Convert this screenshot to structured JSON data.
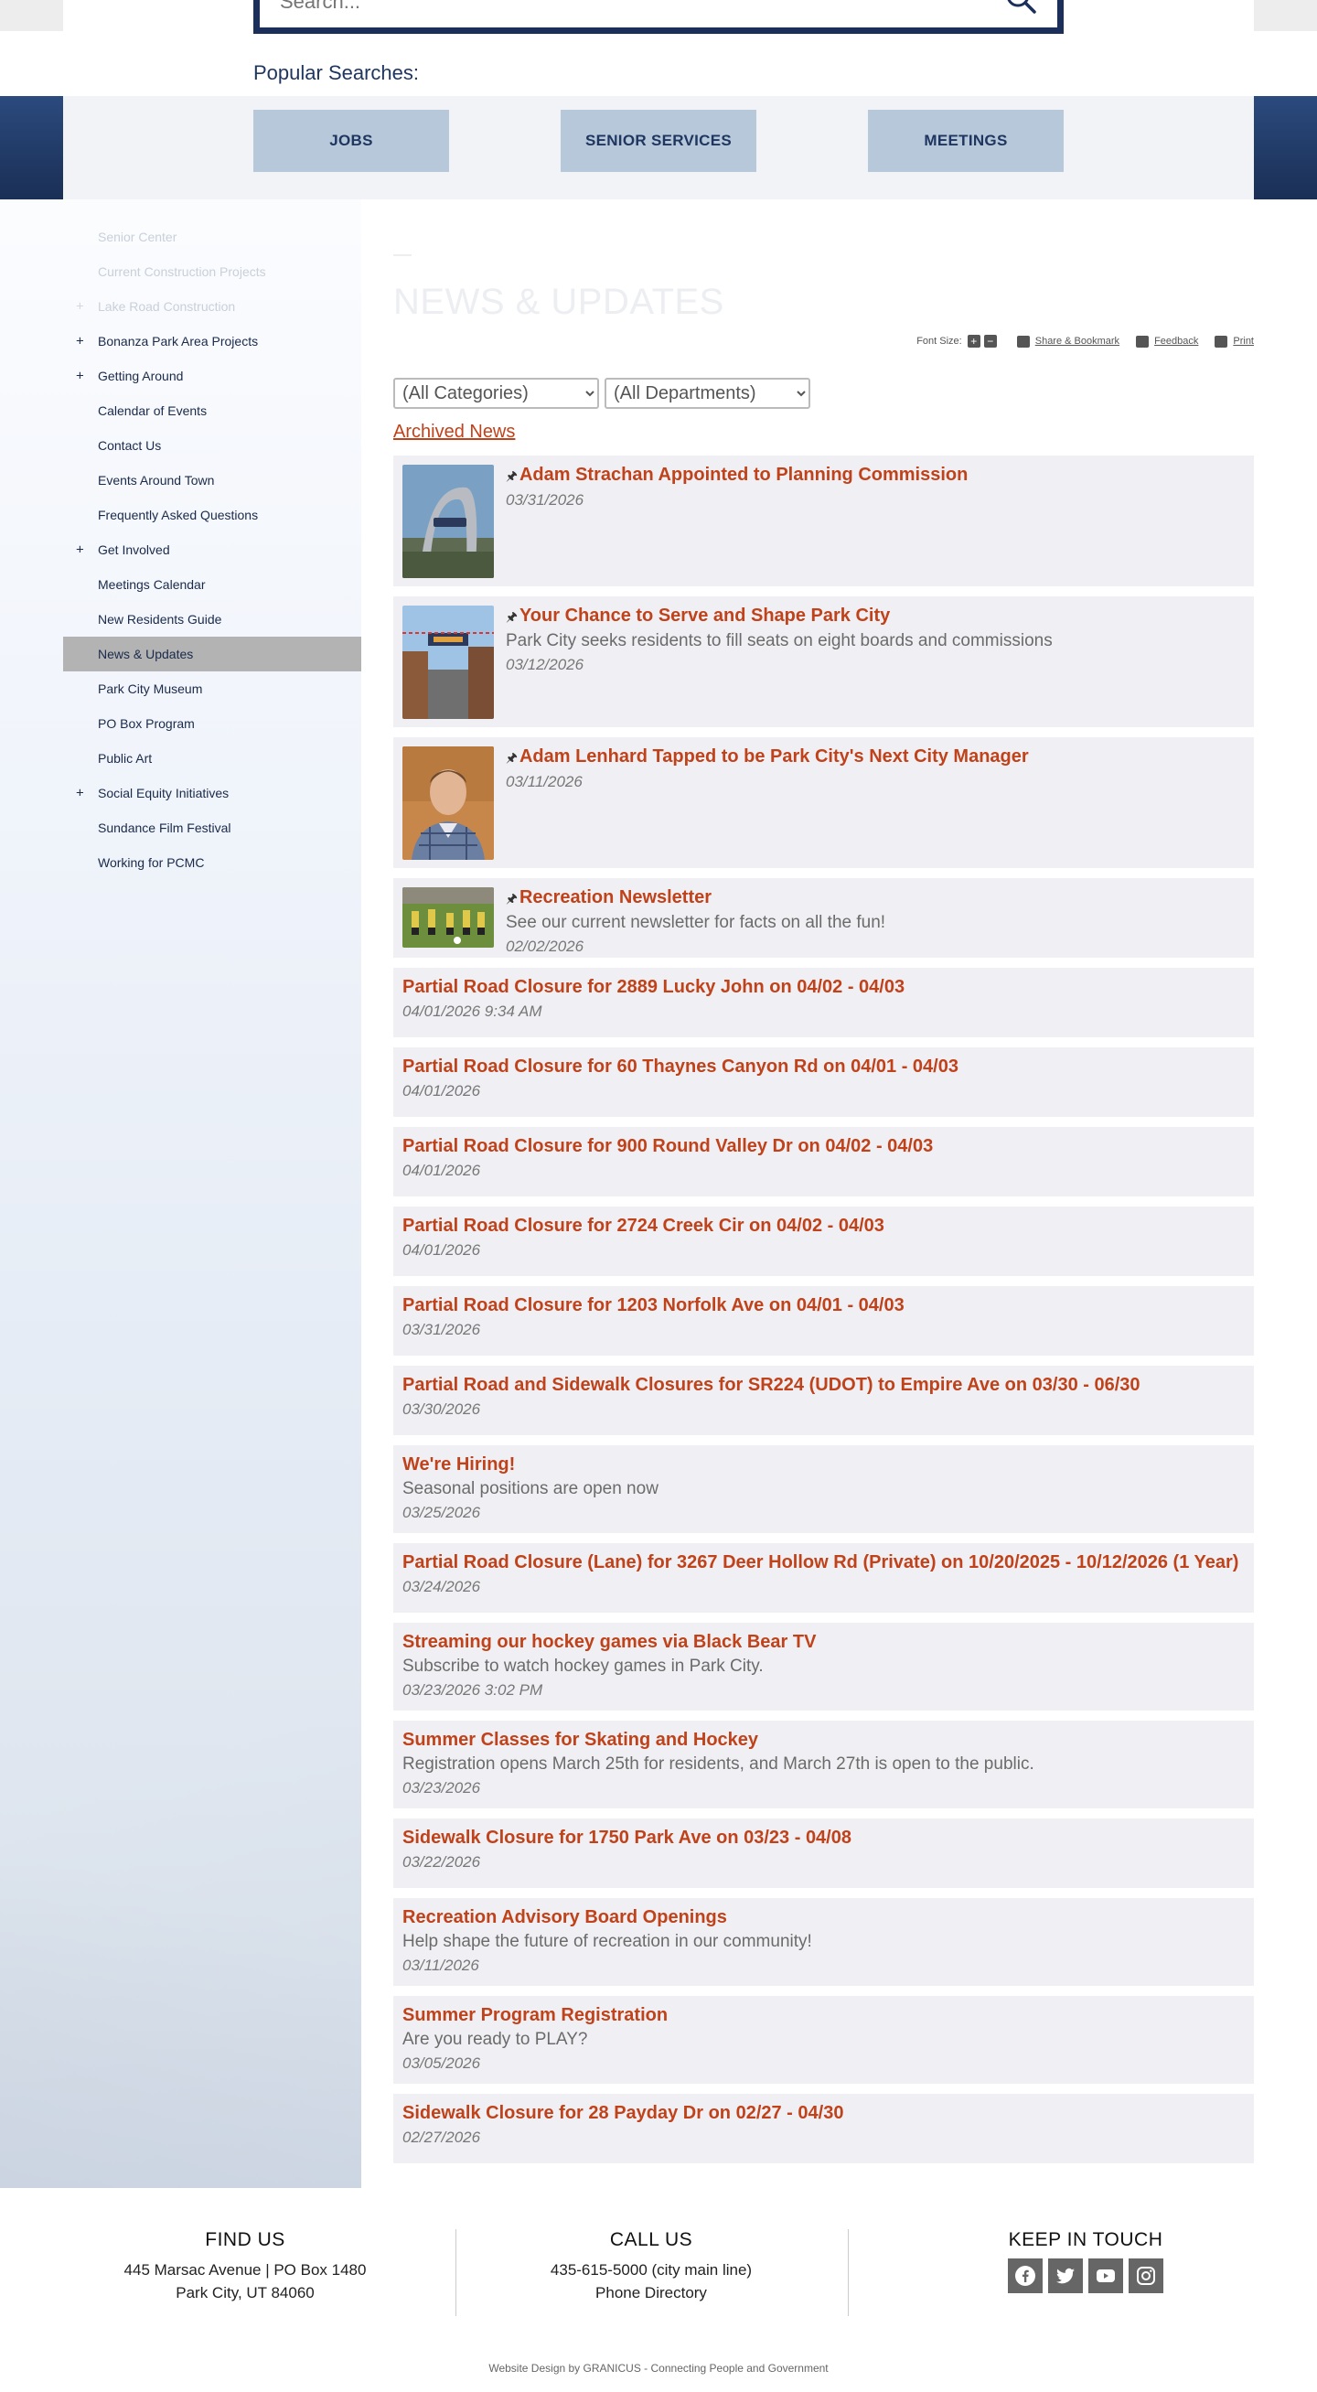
{
  "search": {
    "placeholder": "Search..."
  },
  "popular": {
    "label": "Popular Searches:",
    "buttons": [
      "JOBS",
      "SENIOR SERVICES",
      "MEETINGS"
    ]
  },
  "sidebar": {
    "items": [
      {
        "label": "Senior Center",
        "expand": false,
        "faded": true
      },
      {
        "label": "Current Construction Projects",
        "expand": false,
        "faded": true
      },
      {
        "label": "Lake Road Construction",
        "expand": true,
        "faded": true
      },
      {
        "label": "Bonanza Park Area Projects",
        "expand": true,
        "faded": false
      },
      {
        "label": "Getting Around",
        "expand": true,
        "faded": false
      },
      {
        "label": "Calendar of Events",
        "expand": false,
        "faded": false
      },
      {
        "label": "Contact Us",
        "expand": false,
        "faded": false
      },
      {
        "label": "Events Around Town",
        "expand": false,
        "faded": false
      },
      {
        "label": "Frequently Asked Questions",
        "expand": false,
        "faded": false
      },
      {
        "label": "Get Involved",
        "expand": true,
        "faded": false
      },
      {
        "label": "Meetings Calendar",
        "expand": false,
        "faded": false
      },
      {
        "label": "New Residents Guide",
        "expand": false,
        "faded": false
      },
      {
        "label": "News & Updates",
        "expand": false,
        "faded": false,
        "active": true
      },
      {
        "label": "Park City Museum",
        "expand": false,
        "faded": false
      },
      {
        "label": "PO Box Program",
        "expand": false,
        "faded": false
      },
      {
        "label": "Public Art",
        "expand": false,
        "faded": false
      },
      {
        "label": "Social Equity Initiatives",
        "expand": true,
        "faded": false
      },
      {
        "label": "Sundance Film Festival",
        "expand": false,
        "faded": false
      },
      {
        "label": "Working for PCMC",
        "expand": false,
        "faded": false
      }
    ]
  },
  "page": {
    "title": "NEWS & UPDATES",
    "tools": {
      "font_size_label": "Font Size:",
      "share": "Share & Bookmark",
      "feedback": "Feedback",
      "print": "Print"
    },
    "filters": {
      "categories": "(All Categories)",
      "departments": "(All Departments)"
    },
    "archived_link": "Archived News"
  },
  "news": [
    {
      "title": "Adam Strachan Appointed to Planning Commission",
      "desc": "",
      "date": "03/31/2026",
      "pinned": true,
      "thumb": "sign"
    },
    {
      "title": "Your Chance to Serve and Shape Park City",
      "desc": "Park City seeks residents to fill seats on eight boards and commissions",
      "date": "03/12/2026",
      "pinned": true,
      "thumb": "street"
    },
    {
      "title": "Adam Lenhard Tapped to be Park City's Next City Manager",
      "desc": "",
      "date": "03/11/2026",
      "pinned": true,
      "thumb": "portrait"
    },
    {
      "title": "Recreation Newsletter",
      "desc": "See our current newsletter for facts on all the fun!",
      "date": "02/02/2026",
      "pinned": true,
      "thumb": "field"
    },
    {
      "title": "Partial Road Closure for 2889 Lucky John on 04/02 - 04/03",
      "desc": "",
      "date": "04/01/2026 9:34 AM",
      "pinned": false
    },
    {
      "title": "Partial Road Closure for 60 Thaynes Canyon Rd on 04/01 - 04/03",
      "desc": "",
      "date": "04/01/2026",
      "pinned": false
    },
    {
      "title": "Partial Road Closure for 900 Round Valley Dr on 04/02 - 04/03",
      "desc": "",
      "date": "04/01/2026",
      "pinned": false
    },
    {
      "title": "Partial Road Closure for 2724 Creek Cir on 04/02 - 04/03",
      "desc": "",
      "date": "04/01/2026",
      "pinned": false
    },
    {
      "title": "Partial Road Closure for 1203 Norfolk Ave on 04/01 - 04/03",
      "desc": "",
      "date": "03/31/2026",
      "pinned": false
    },
    {
      "title": "Partial Road and Sidewalk Closures for SR224 (UDOT) to Empire Ave on 03/30 - 06/30",
      "desc": "",
      "date": "03/30/2026",
      "pinned": false
    },
    {
      "title": "We're Hiring!",
      "desc": "Seasonal positions are open now",
      "date": "03/25/2026",
      "pinned": false
    },
    {
      "title": "Partial Road Closure (Lane) for 3267 Deer Hollow Rd (Private) on 10/20/2025 - 10/12/2026 (1 Year)",
      "desc": "",
      "date": "03/24/2026",
      "pinned": false
    },
    {
      "title": "Streaming our hockey games via Black Bear TV",
      "desc": "Subscribe to watch hockey games in Park City.",
      "date": "03/23/2026 3:02 PM",
      "pinned": false
    },
    {
      "title": "Summer Classes for Skating and Hockey",
      "desc": "Registration opens March 25th for residents, and March 27th is open to the public.",
      "date": "03/23/2026",
      "pinned": false
    },
    {
      "title": "Sidewalk Closure for 1750 Park Ave on 03/23 - 04/08",
      "desc": "",
      "date": "03/22/2026",
      "pinned": false
    },
    {
      "title": "Recreation Advisory Board Openings",
      "desc": "Help shape the future of recreation in our community!",
      "date": "03/11/2026",
      "pinned": false
    },
    {
      "title": "Summer Program Registration",
      "desc": "Are you ready to PLAY?",
      "date": "03/05/2026",
      "pinned": false
    },
    {
      "title": "Sidewalk Closure for 28 Payday Dr on 02/27 - 04/30",
      "desc": "",
      "date": "02/27/2026",
      "pinned": false
    }
  ],
  "footer": {
    "find": {
      "heading": "FIND US",
      "line1": "445 Marsac Avenue | PO Box 1480",
      "line2": "Park City, UT 84060"
    },
    "call": {
      "heading": "CALL US",
      "line1": "435-615-5000 (city main line)",
      "line2": "Phone Directory"
    },
    "touch": {
      "heading": "KEEP IN TOUCH",
      "icons": [
        "facebook-icon",
        "twitter-icon",
        "youtube-icon",
        "instagram-icon"
      ]
    },
    "credit": "Website Design by GRANICUS - Connecting People and Government"
  },
  "colors": {
    "navy": "#1f3660",
    "link": "#c0421a",
    "popular_button": "#b6c8d9"
  }
}
